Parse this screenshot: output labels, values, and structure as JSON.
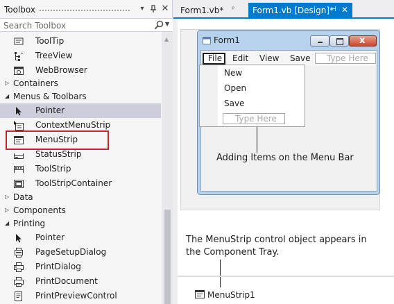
{
  "toolbox": {
    "title": "Toolbox",
    "pin_glyph": "▾",
    "search_placeholder": "Search Toolbox",
    "items_top": [
      {
        "label": "ToolTip",
        "icon": "tooltip-icon"
      },
      {
        "label": "TreeView",
        "icon": "treeview-icon"
      },
      {
        "label": "WebBrowser",
        "icon": "webbrowser-icon"
      }
    ],
    "cat_containers": "Containers",
    "cat_menus": "Menus & Toolbars",
    "items_menus": [
      {
        "label": "Pointer",
        "icon": "pointer-icon",
        "selected": true
      },
      {
        "label": "ContextMenuStrip",
        "icon": "contextmenustrip-icon"
      },
      {
        "label": "MenuStrip",
        "icon": "menustrip-icon",
        "highlighted": true
      },
      {
        "label": "StatusStrip",
        "icon": "statusstrip-icon"
      },
      {
        "label": "ToolStrip",
        "icon": "toolstrip-icon"
      },
      {
        "label": "ToolStripContainer",
        "icon": "toolstripcontainer-icon"
      }
    ],
    "cat_data": "Data",
    "cat_components": "Components",
    "cat_printing": "Printing",
    "items_printing": [
      {
        "label": "Pointer",
        "icon": "pointer-icon"
      },
      {
        "label": "PageSetupDialog",
        "icon": "pagesetupdialog-icon"
      },
      {
        "label": "PrintDialog",
        "icon": "printdialog-icon"
      },
      {
        "label": "PrintDocument",
        "icon": "printdocument-icon"
      },
      {
        "label": "PrintPreviewControl",
        "icon": "printpreviewcontrol-icon"
      }
    ],
    "highlight_color": "#c8232c"
  },
  "tabs": [
    {
      "label": "Form1.vb*",
      "active": false
    },
    {
      "label": "Form1.vb [Design]*",
      "active": true
    }
  ],
  "accent_color": "#007acc",
  "form": {
    "title": "Form1",
    "menu": [
      "File",
      "Edit",
      "View",
      "Save"
    ],
    "menu_placeholder": "Type Here",
    "dropdown": [
      "New",
      "Open",
      "Save"
    ],
    "dropdown_placeholder": "Type Here"
  },
  "annotations": {
    "menu_bar": "Adding Items on the Menu Bar",
    "tray_line1": "The MenuStrip control object appears in",
    "tray_line2": "the Component Tray."
  },
  "component_tray": {
    "item": "MenuStrip1"
  }
}
